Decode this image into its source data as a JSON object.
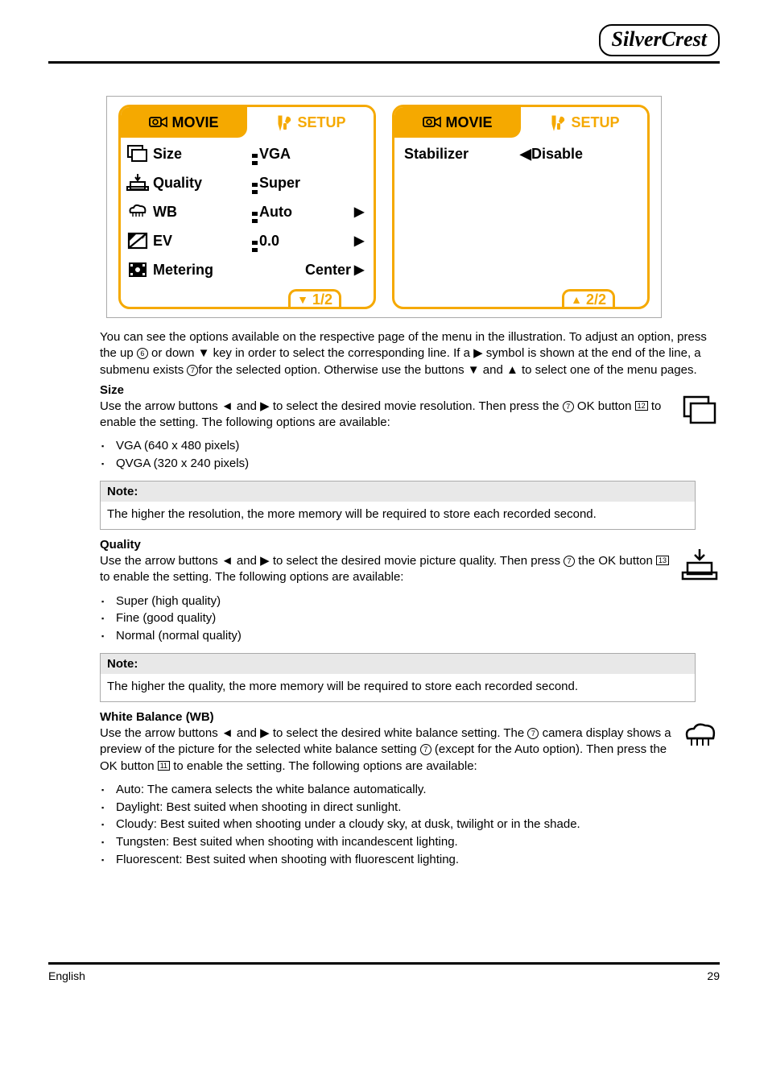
{
  "brand": "SilverCrest",
  "screens": {
    "left": {
      "tab_movie": "MOVIE",
      "tab_setup": "SETUP",
      "rows": [
        {
          "label": "Size",
          "value": "VGA",
          "arrow": false
        },
        {
          "label": "Quality",
          "value": "Super",
          "arrow": false
        },
        {
          "label": "WB",
          "value": "Auto",
          "arrow": true
        },
        {
          "label": "EV",
          "value": "0.0",
          "arrow": true
        },
        {
          "label": "Metering",
          "value": "Center",
          "arrow": true
        }
      ],
      "pager": "1/2",
      "pager_dir": "down"
    },
    "right": {
      "tab_movie": "MOVIE",
      "tab_setup": "SETUP",
      "row_label": "Stabilizer",
      "row_value": "Disable",
      "pager": "2/2",
      "pager_dir": "up"
    }
  },
  "body": {
    "p1": "You can see the options available on the respective page of the menu in the illustration. To adjust an option, press the up ",
    "p1b": " or down ▼ key in order to select the corresponding line. If a ▶ symbol is shown at the end of the line, a submenu exists ",
    "p1c": "for the selected option. Otherwise use the buttons  ▼ and  ▲ to select one of the menu pages.",
    "size_h": "Size",
    "size_p1a": "Use the arrow buttons  ◄ and ▶ to select the desired movie resolution. Then press the ",
    "size_p1b": "OK button ",
    "size_p1c": " to enable the setting. The following options are available:",
    "size_li1": "VGA (640 x 480 pixels)",
    "size_li2": "QVGA (320 x 240 pixels)",
    "size_note_h": "Note:",
    "size_note_b": "The higher the resolution, the more memory will be required to store each recorded second.",
    "quality_h": "Quality",
    "quality_p1a": "Use the arrow buttons  ◄ and ▶ to select the desired movie picture quality. Then press ",
    "quality_p1b": "the OK button ",
    "quality_p1c": " to enable the setting. The following options are available:",
    "quality_li1": "Super (high quality)",
    "quality_li2": "Fine (good quality)",
    "quality_li3": "Normal (normal quality)",
    "quality_note_h": "Note:",
    "quality_note_b": "The higher the quality, the more memory will be required to store each recorded second.",
    "wb_h": "White Balance (WB)",
    "wb_p1a": "Use the arrow buttons  ◄ and  ▶ to select the desired white balance setting. The ",
    "wb_p1b": "camera display shows a preview of the picture for the selected white balance setting ",
    "wb_p1c": "(except for the Auto option). Then press the OK button ",
    "wb_p1d": " to enable the setting. The following options are available:",
    "wb_li1_a": "Auto: The camera selects the white balance automatically.",
    "wb_li2_a": "Daylight: Best suited when shooting in direct sunlight.",
    "wb_li3_a": "Cloudy: Best suited when shooting under a cloudy sky, at dusk, twilight or in the shade.",
    "wb_li4_a": "Tungsten: Best suited when shooting with incandescent lighting.",
    "wb_li5_a": "Fluorescent: Best suited when shooting with fluorescent lighting."
  },
  "footer": {
    "left": "English",
    "right": "29"
  },
  "refs": {
    "six": "6",
    "seven": "7",
    "eleven": "11",
    "twelve": "12",
    "thirteen": "13"
  }
}
